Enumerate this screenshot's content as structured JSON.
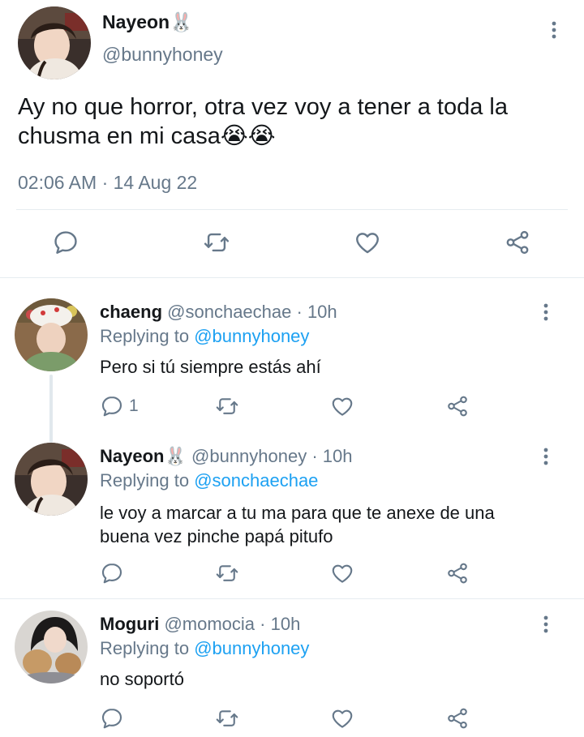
{
  "main_tweet": {
    "name": "Nayeon",
    "name_emoji": "🐰",
    "handle": "@bunnyhoney",
    "text": "Ay no que horror, otra vez voy a tener a toda la chusma en mi casa",
    "emojis": [
      "😭",
      "😭"
    ],
    "timestamp": "02:06 AM · 14 Aug 22"
  },
  "replies": [
    {
      "name": "chaeng",
      "name_emoji": "",
      "handle": "@sonchaechae",
      "time": "· 10h",
      "replying_prefix": "Replying to",
      "replying_handle": "@bunnyhoney",
      "text_lines": [
        "Pero si tú siempre estás ahí"
      ],
      "reply_count": "1"
    },
    {
      "name": "Nayeon",
      "name_emoji": "🐰",
      "handle": "@bunnyhoney",
      "time": "· 10h",
      "replying_prefix": "Replying to",
      "replying_handle": "@sonchaechae",
      "text_lines": [
        "le voy a marcar a tu ma para que te anexe de una",
        "buena vez pinche papá pitufo"
      ],
      "reply_count": ""
    },
    {
      "name": "Moguri",
      "name_emoji": "",
      "handle": "@momocia",
      "time": "· 10h",
      "replying_prefix": "Replying to",
      "replying_handle": "@bunnyhoney",
      "text_lines": [
        "no soportó"
      ],
      "reply_count": ""
    }
  ],
  "colors": {
    "text": "#14171a",
    "secondary": "#66788a",
    "link": "#1da1f2",
    "divider": "#e6ecf0"
  },
  "icons": [
    "more-vertical-icon",
    "reply-icon",
    "retweet-icon",
    "like-icon",
    "share-icon"
  ]
}
